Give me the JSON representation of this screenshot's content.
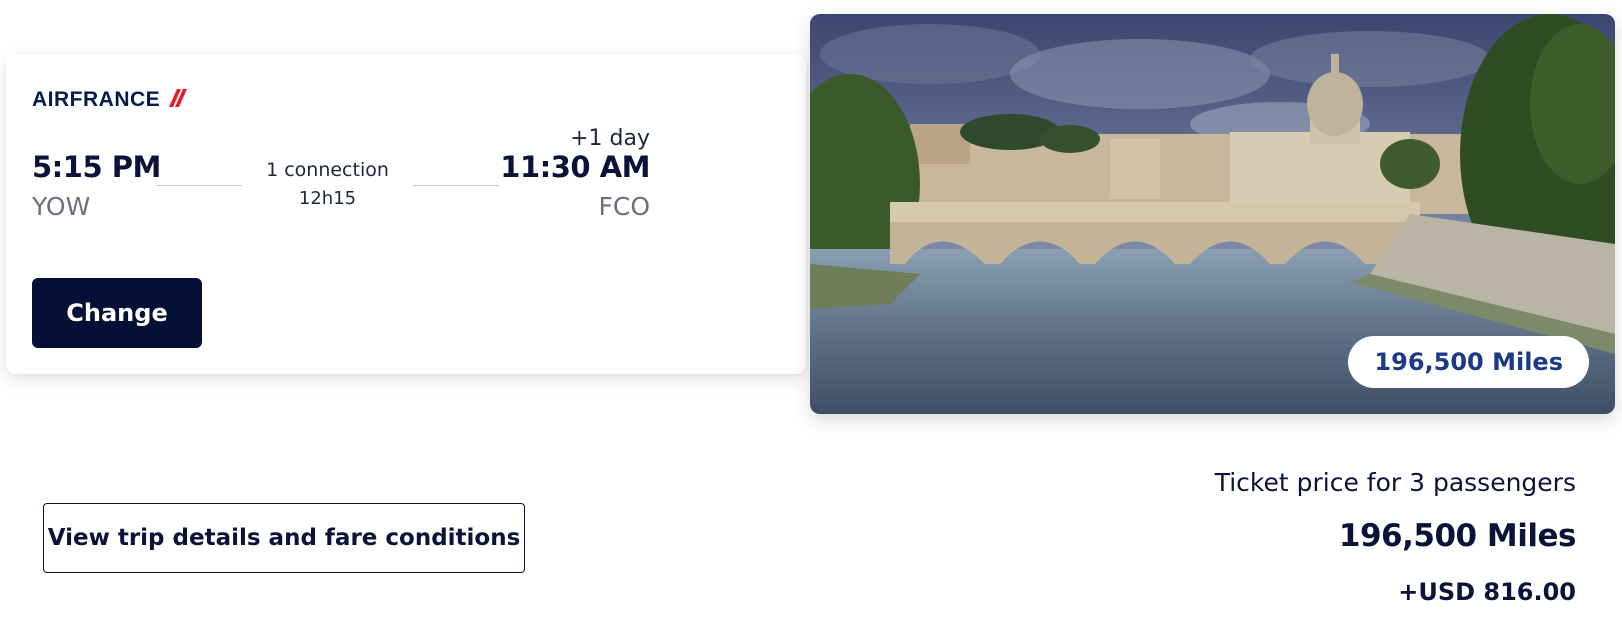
{
  "flight": {
    "airline": "AIRFRANCE",
    "departure_time": "5:15 PM",
    "departure_code": "YOW",
    "connection_label": "1 connection",
    "duration": "12h15",
    "day_offset": "+1 day",
    "arrival_time": "11:30 AM",
    "arrival_code": "FCO",
    "change_label": "Change"
  },
  "destination": {
    "miles_badge": "196,500 Miles"
  },
  "details_link": "View trip details and fare conditions",
  "price": {
    "label": "Ticket price for 3 passengers",
    "miles": "196,500 Miles",
    "usd": "+USD 816.00"
  },
  "colors": {
    "brand_navy": "#051037",
    "miles_blue": "#1c3a86",
    "airfrance_red": "#e3202a"
  },
  "icons": {
    "logo_mark": "airfrance-stripe-icon"
  }
}
